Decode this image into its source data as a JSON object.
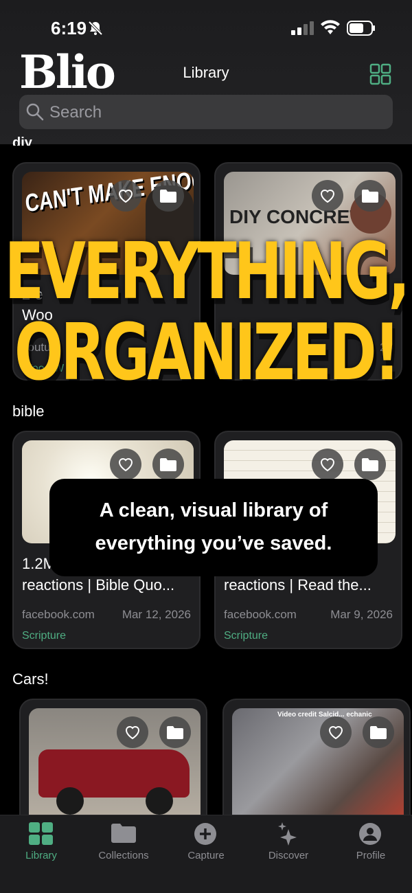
{
  "status_bar": {
    "time": "6:19"
  },
  "header": {
    "logo": "Blio",
    "title": "Library"
  },
  "search": {
    "placeholder": "Search"
  },
  "sections": [
    {
      "name": "diy",
      "cards": [
        {
          "thumb_text": "CAN'T MAKE ENOUGH",
          "title_partial": "2 e",
          "title_line2": "Woo",
          "source": "youtu.",
          "date": "26",
          "tag": "Wood W"
        },
        {
          "thumb_text": "DIY CONCRETE",
          "title_partial": "",
          "title_line2": "",
          "source": "",
          "date": "26",
          "tag": ""
        }
      ]
    },
    {
      "name": "bible",
      "cards": [
        {
          "title_partial": "1.2M",
          "title_line2": "reactions | Bible Quo...",
          "source": "facebook.com",
          "date": "Mar 12, 2026",
          "tag": "Scripture"
        },
        {
          "title_partial": "",
          "title_line2": "reactions | Read the...",
          "source": "facebook.com",
          "date": "Mar 9, 2026",
          "tag": "Scripture"
        }
      ]
    },
    {
      "name": "Cars!",
      "cards": [
        {
          "thumb_text": ""
        },
        {
          "thumb_text": "Video credit Salcid... echanic"
        }
      ]
    }
  ],
  "overlay": {
    "headline_line1": "EVERYTHING,",
    "headline_line2": "ORGANIZED!",
    "caption_line1": "A clean, visual library of",
    "caption_line2": "everything you’ve saved."
  },
  "tabs": [
    {
      "label": "Library",
      "active": true,
      "icon": "library-grid-icon"
    },
    {
      "label": "Collections",
      "active": false,
      "icon": "folder-icon"
    },
    {
      "label": "Capture",
      "active": false,
      "icon": "plus-circle-icon"
    },
    {
      "label": "Discover",
      "active": false,
      "icon": "sparkles-icon"
    },
    {
      "label": "Profile",
      "active": false,
      "icon": "person-icon"
    }
  ],
  "colors": {
    "accent": "#4fae83",
    "headline": "#ffc61a",
    "background": "#000000"
  }
}
